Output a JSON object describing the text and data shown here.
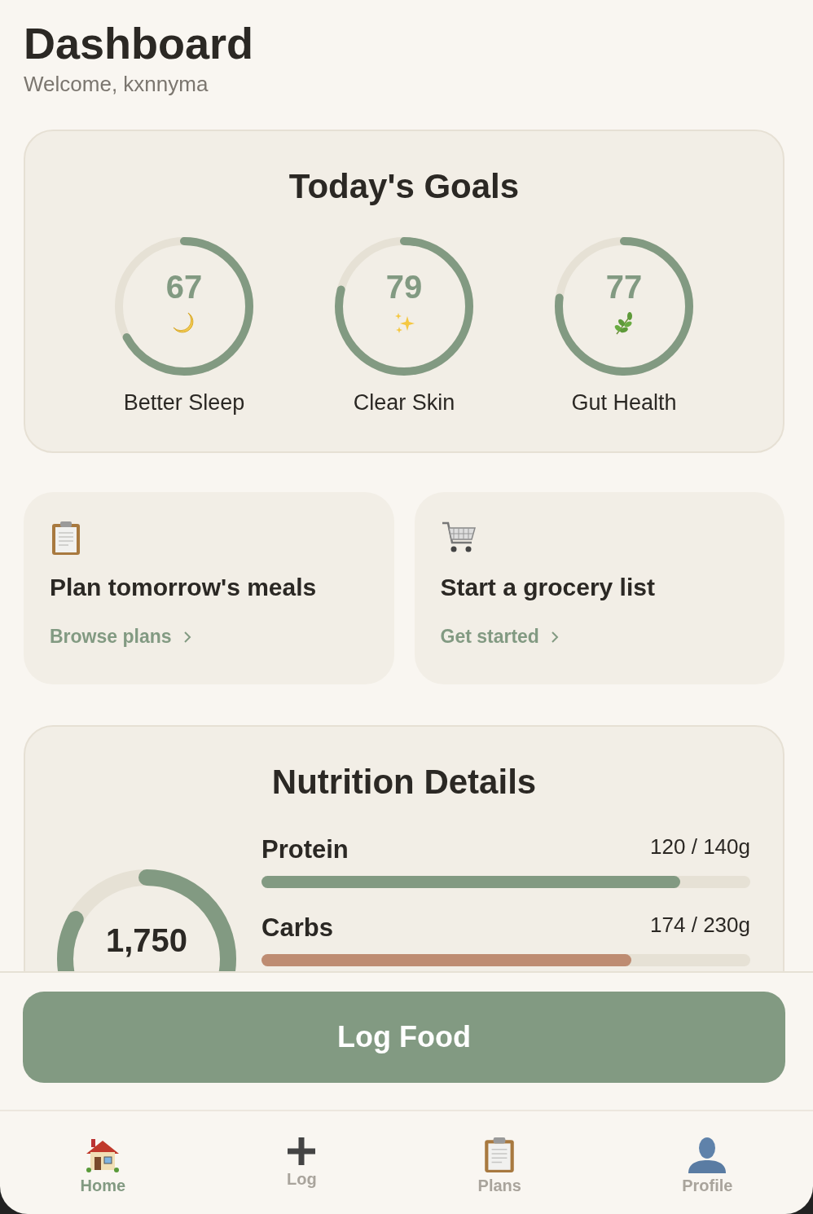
{
  "header": {
    "title": "Dashboard",
    "subtitle": "Welcome, kxnnyma"
  },
  "goals": {
    "title": "Today's Goals",
    "items": [
      {
        "value": "67",
        "label": "Better Sleep",
        "level": 0.67,
        "kind": "moon"
      },
      {
        "value": "79",
        "label": "Clear Skin",
        "level": 0.79,
        "kind": "sparkles"
      },
      {
        "value": "77",
        "label": "Gut Health",
        "level": 0.77,
        "kind": "leaf"
      }
    ]
  },
  "actions": [
    {
      "kind": "clipboard",
      "title": "Plan tomorrow's meals",
      "link": "Browse plans"
    },
    {
      "kind": "cart",
      "title": "Start a grocery list",
      "link": "Get started"
    }
  ],
  "nutrition": {
    "title": "Nutrition Details",
    "calories": {
      "value": "1,750"
    },
    "macros": [
      {
        "name": "Protein",
        "reading": "120 / 140g",
        "level": 0.857,
        "color": "#829a82"
      },
      {
        "name": "Carbs",
        "reading": "174 / 230g",
        "level": 0.757,
        "color": "#be8c72"
      }
    ]
  },
  "primary_button": "Log Food",
  "nav": [
    {
      "label": "Home",
      "kind": "home",
      "selected": true
    },
    {
      "label": "Log",
      "kind": "plus",
      "selected": false
    },
    {
      "label": "Plans",
      "kind": "clipboard",
      "selected": false
    },
    {
      "label": "Profile",
      "kind": "person",
      "selected": false
    }
  ]
}
